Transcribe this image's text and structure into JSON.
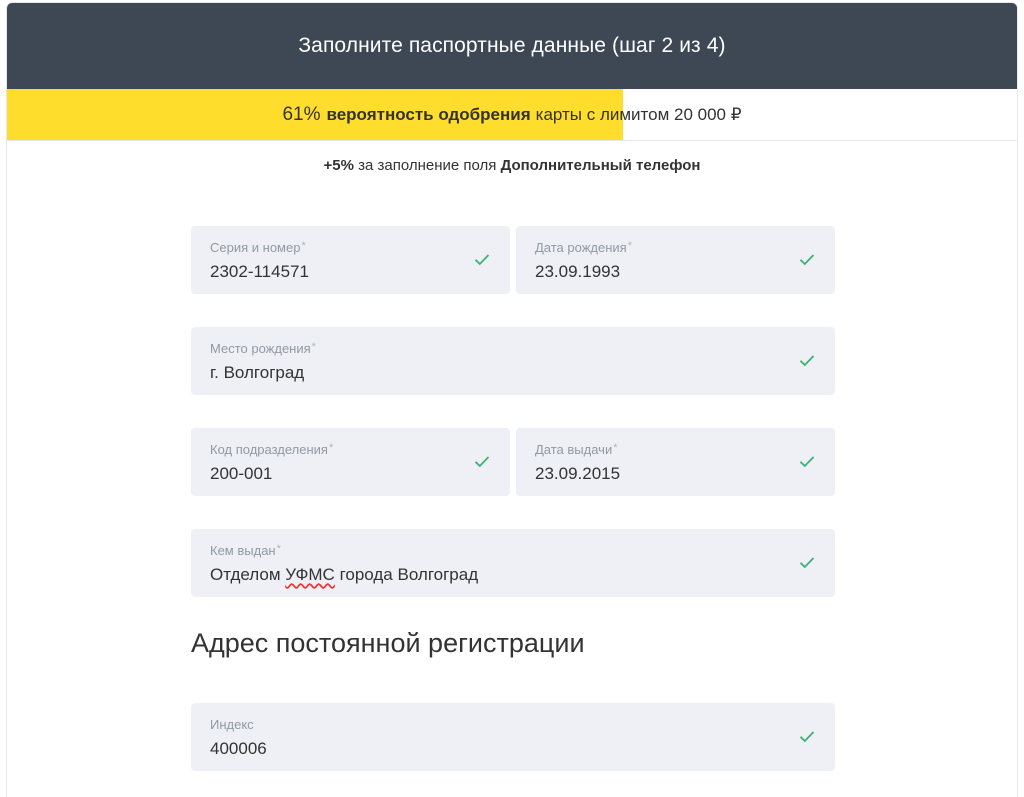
{
  "header": {
    "title": "Заполните паспортные данные (шаг 2 из 4)"
  },
  "approval": {
    "percent_text": "61%",
    "percent_value": 61,
    "bold_text": "вероятность одобрения",
    "rest_text": "карты с лимитом 20 000 ₽",
    "fill_color": "#ffdd2d"
  },
  "hint": {
    "bonus": "+5%",
    "text": "за заполнение поля",
    "field_name": "Дополнительный телефон"
  },
  "fields": {
    "series": {
      "label": "Серия и номер",
      "value": "2302-114571",
      "required_mark": "*"
    },
    "birth_date": {
      "label": "Дата рождения",
      "value": "23.09.1993",
      "required_mark": "*"
    },
    "birth_place": {
      "label": "Место рождения",
      "value": "г. Волгоград",
      "required_mark": "*"
    },
    "dept_code": {
      "label": "Код подразделения",
      "value": "200-001",
      "required_mark": "*"
    },
    "issue_date": {
      "label": "Дата выдачи",
      "value": "23.09.2015",
      "required_mark": "*"
    },
    "issued_by": {
      "label": "Кем выдан",
      "value_before": "Отделом ",
      "value_flagged": "УФМС",
      "value_after": " города Волгоград",
      "required_mark": "*"
    },
    "index": {
      "label": "Индекс",
      "value": "400006"
    }
  },
  "section": {
    "title": "Адрес постоянной регистрации"
  },
  "colors": {
    "header_bg": "#3e4855",
    "field_bg": "#eef0f5",
    "check_green": "#3cb371",
    "accent_yellow": "#ffdd2d"
  },
  "icons": {
    "valid": "check-icon"
  }
}
